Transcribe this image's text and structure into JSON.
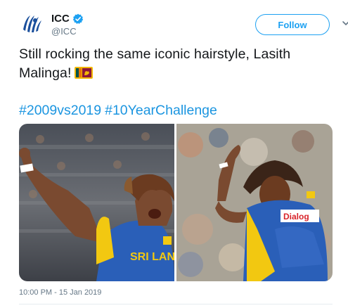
{
  "account": {
    "display_name": "ICC",
    "handle": "@ICC",
    "verified": true,
    "avatar_icon": "icc-logo-icon",
    "brand_color": "#1a4f9c"
  },
  "actions": {
    "follow_label": "Follow",
    "menu_icon": "chevron-down-icon"
  },
  "tweet": {
    "text": "Still rocking the same iconic hairstyle, Lasith Malinga!",
    "flag_icon": "sri-lanka-flag-icon",
    "hashtags": [
      "#2009vs2019",
      "#10YearChallenge"
    ],
    "timestamp": "10:00 PM - 15 Jan 2019"
  },
  "media": {
    "left_photo": {
      "jersey_text": "SRI LANK"
    },
    "right_photo": {
      "jersey_text": "Dialog"
    }
  },
  "colors": {
    "link": "#1b95e0",
    "follow": "#1da1f2",
    "muted": "#657786",
    "jersey": "#2a5fb8",
    "jersey_accent": "#f2c811"
  }
}
